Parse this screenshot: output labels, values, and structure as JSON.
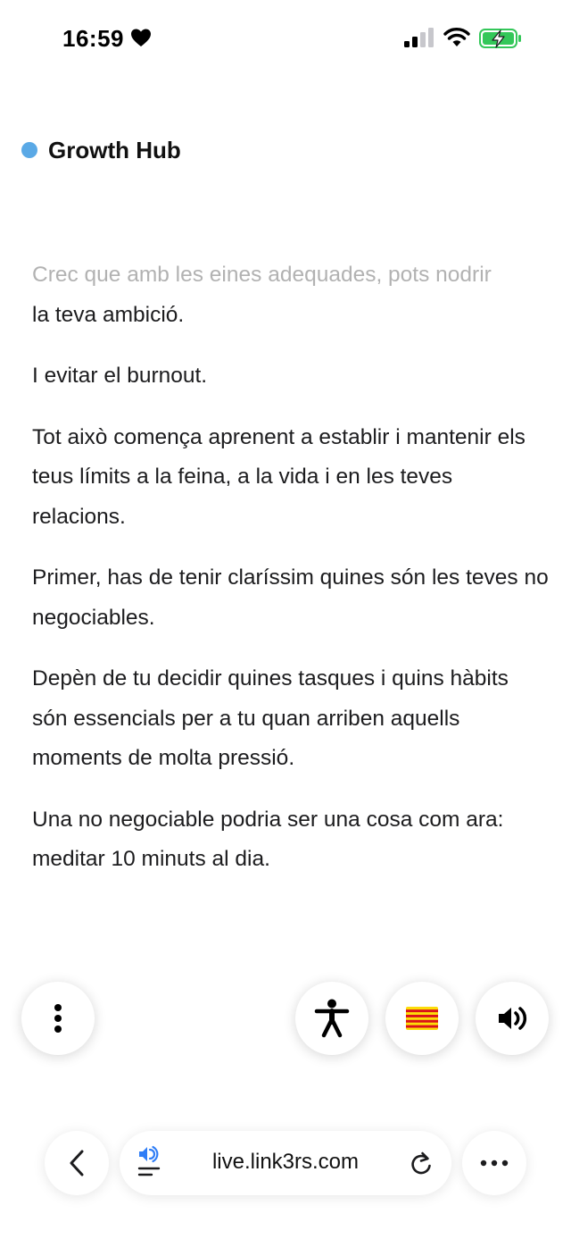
{
  "status_bar": {
    "time": "16:59",
    "icons": [
      "heart-icon",
      "signal-icon",
      "wifi-icon",
      "battery-charging-icon"
    ],
    "battery_color": "#34c759"
  },
  "header": {
    "brand_name": "Growth Hub",
    "brand_dot_color": "#5aa9e6"
  },
  "content": {
    "paragraphs": [
      {
        "faded": "Crec que amb les eines adequades, pots nodrir",
        "text": "la teva ambició."
      },
      {
        "faded": "",
        "text": "I evitar el burnout."
      },
      {
        "faded": "",
        "text": "Tot això comença aprenent a establir i mantenir els teus límits a la feina, a la vida i en les teves relacions."
      },
      {
        "faded": "",
        "text": "Primer, has de tenir claríssim quines són les teves no negociables."
      },
      {
        "faded": "",
        "text": "Depèn de tu decidir quines tasques i quins hàbits són essencials per a tu quan arriben aquells moments de molta pressió."
      },
      {
        "faded": "",
        "text": "Una no negociable podria ser una cosa com ara: meditar 10 minuts al dia."
      }
    ]
  },
  "floating_buttons": {
    "icons": [
      "more-vertical-icon",
      "accessibility-icon",
      "catalan-flag-icon",
      "speaker-icon"
    ],
    "flag_colors": [
      "#fcdd09",
      "#da121a"
    ]
  },
  "browser_toolbar": {
    "url": "live.link3rs.com",
    "icons": [
      "back-chevron-icon",
      "audio-reader-icon",
      "reload-icon",
      "more-horizontal-icon"
    ],
    "accent_color": "#2f7df6"
  }
}
